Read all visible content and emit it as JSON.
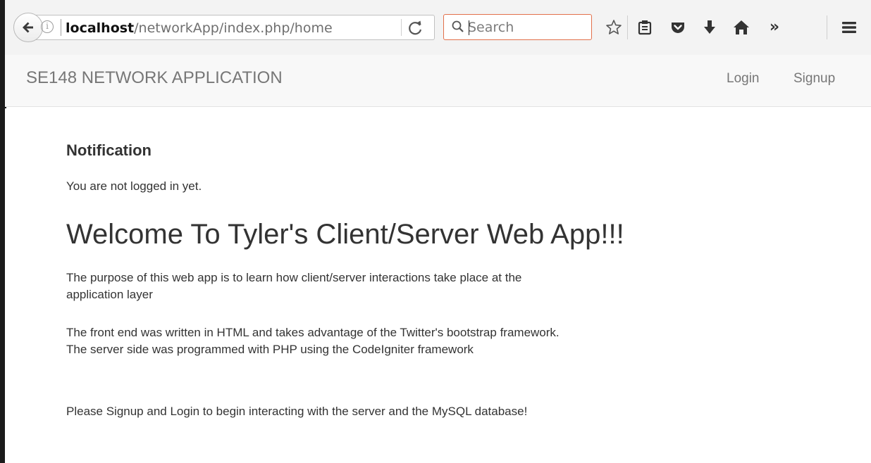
{
  "browser": {
    "url_host": "localhost",
    "url_path": "/networkApp/index.php/home",
    "search_placeholder": "Search",
    "overflow_label": "»"
  },
  "navbar": {
    "brand": "SE148 NETWORK APPLICATION",
    "login_label": "Login",
    "signup_label": "Signup"
  },
  "notification": {
    "title": "Notification",
    "message": "You are not logged in yet."
  },
  "main": {
    "heading": "Welcome To Tyler's Client/Server Web App!!!",
    "paragraph_1": "The purpose of this web app is to learn how client/server interactions take place at the application layer",
    "paragraph_2": "The front end was written in HTML and takes advantage of the Twitter's bootstrap framework. The server side was programmed with PHP using the CodeIgniter framework",
    "paragraph_3": "Please Signup and Login to begin interacting with the server and the MySQL database!"
  },
  "colors": {
    "search_focus_border": "#e2704a",
    "navbar_bg": "#f8f8f8",
    "text": "#333333",
    "nav_text": "#777777"
  },
  "icons": [
    "back-arrow-icon",
    "info-icon",
    "reload-icon",
    "search-icon",
    "bookmark-star-icon",
    "reading-list-icon",
    "pocket-icon",
    "download-icon",
    "home-icon",
    "overflow-chevron-icon",
    "hamburger-menu-icon"
  ]
}
